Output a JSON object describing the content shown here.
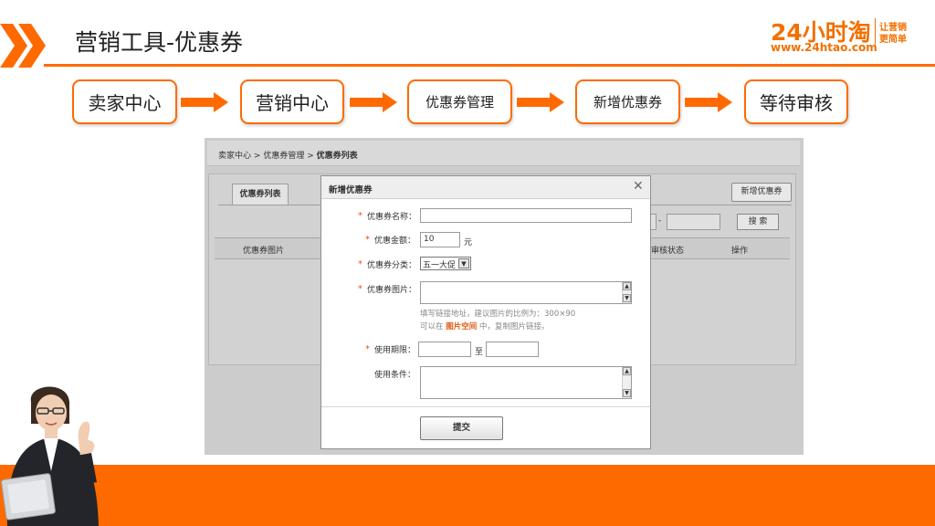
{
  "header": {
    "title": "营销工具-优惠券",
    "logo_number": "24小时淘",
    "logo_url": "www.24htao.com",
    "logo_slogan_line1": "让营销",
    "logo_slogan_line2": "更简单"
  },
  "flow": {
    "steps": [
      "卖家中心",
      "营销中心",
      "优惠券管理",
      "新增优惠券",
      "等待审核"
    ]
  },
  "screen": {
    "breadcrumb": {
      "item1": "卖家中心",
      "sep": ">",
      "item2": "优惠券管理",
      "current": "优惠券列表"
    },
    "tab_label": "优惠券列表",
    "new_coupon_button": "新增优惠券",
    "date_separator": "-",
    "search_button": "搜 索",
    "table_headers": {
      "image": "优惠券图片",
      "audit_status": "审核状态",
      "action": "操作"
    }
  },
  "dialog": {
    "title": "新增优惠券",
    "close_icon": "close-icon",
    "required_mark": "*",
    "fields": {
      "name_label": "优惠券名称：",
      "name_value": "",
      "amount_label": "优惠金额：",
      "amount_value": "10",
      "amount_unit": "元",
      "category_label": "优惠券分类：",
      "category_value": "五一大促",
      "image_label": "优惠券图片：",
      "image_hint": "填写链接地址，建议图片的比例为：300×90",
      "image_hint2_prefix": "可以在",
      "image_hint2_link": "图片空间",
      "image_hint2_suffix": "中，复制图片链接。",
      "period_label": "使用期限：",
      "period_to": "至",
      "condition_label": "使用条件："
    },
    "submit_button": "提交"
  },
  "colors": {
    "accent": "#ff6a00",
    "required": "#e8560f",
    "logo": "#f27000"
  }
}
